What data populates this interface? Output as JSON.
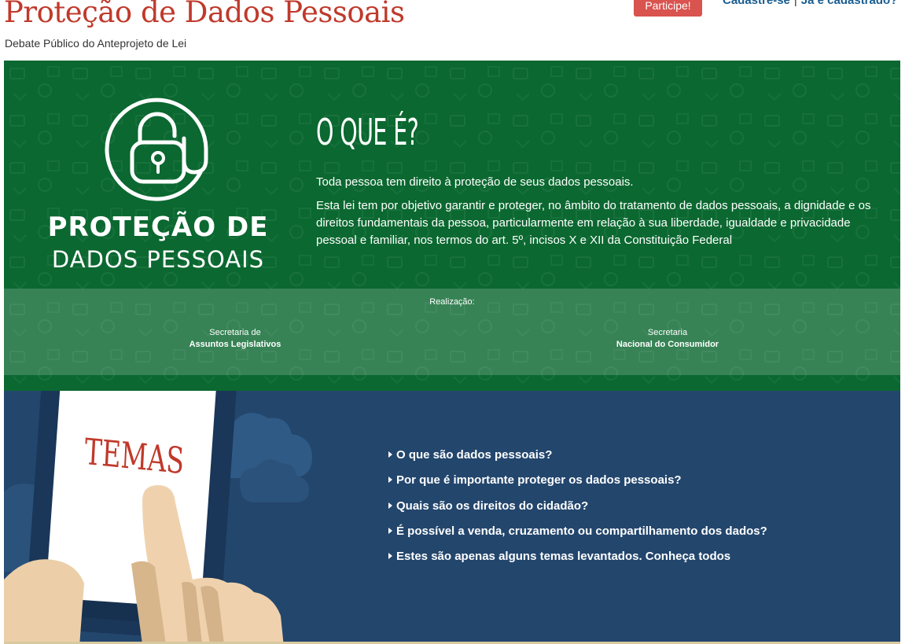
{
  "header": {
    "title": "Proteção de Dados Pessoais",
    "subtitle": "Debate Público do Anteprojeto de Lei",
    "participe_button": "Participe!",
    "cadastre_link": "Cadastre-se",
    "separator": "|",
    "login_link": "Já é cadastrado?"
  },
  "intro": {
    "logo_line1": "PROTEÇÃO DE",
    "logo_line2": "DADOS PESSOAIS",
    "heading": "O QUE É?",
    "paragraph1": "Toda pessoa tem direito à proteção de seus dados pessoais.",
    "paragraph2": "Esta lei tem por objetivo garantir e proteger, no âmbito do tratamento de dados pessoais, a dignidade e os direitos fundamentais da pessoa, particularmente em relação à sua liberdade, igualdade e privacidade pessoal e familiar, nos termos do art. 5º, incisos X e XII da Constituição Federal"
  },
  "realizacao": {
    "label": "Realização:",
    "org1_line1": "Secretaria de",
    "org1_line2": "Assuntos Legislativos",
    "org2_line1": "Secretaria",
    "org2_line2": "Nacional do Consumidor"
  },
  "temas": {
    "heading": "TEMAS",
    "items": [
      "O que são dados pessoais?",
      "Por que é importante proteger os dados pessoais?",
      "Quais são os direitos do cidadão?",
      "É possível a venda, cruzamento ou compartilhamento dos dados?",
      "Estes são apenas alguns temas levantados. Conheça todos"
    ]
  },
  "colors": {
    "title_red": "#c0392b",
    "green_banner": "#0b6830",
    "blue_banner": "#23466d",
    "button_red": "#d9534f",
    "link_blue": "#1a5d8f"
  }
}
